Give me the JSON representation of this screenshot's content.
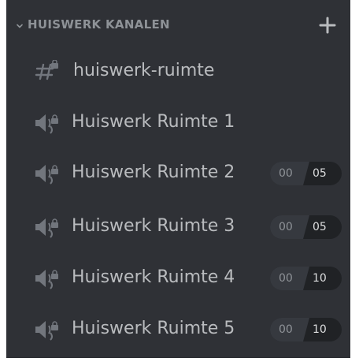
{
  "category": {
    "label": "HUISWERK KANALEN",
    "chevron_icon": "chevron-down-icon",
    "add_icon": "plus-icon"
  },
  "channels": [
    {
      "type": "text",
      "icon": "text-channel-locked-icon",
      "name": "huiswerk-ruimte"
    },
    {
      "type": "voice",
      "icon": "voice-channel-locked-icon",
      "name": "Huiswerk Ruimte 1"
    },
    {
      "type": "voice",
      "icon": "voice-channel-locked-icon",
      "name": "Huiswerk Ruimte 2",
      "users": "00",
      "limit": "05"
    },
    {
      "type": "voice",
      "icon": "voice-channel-locked-icon",
      "name": "Huiswerk Ruimte 3",
      "users": "00",
      "limit": "05"
    },
    {
      "type": "voice",
      "icon": "voice-channel-locked-icon",
      "name": "Huiswerk Ruimte 4",
      "users": "00",
      "limit": "10"
    },
    {
      "type": "voice",
      "icon": "voice-channel-locked-icon",
      "name": "Huiswerk Ruimte 5",
      "users": "00",
      "limit": "10"
    }
  ],
  "colors": {
    "panel_background": "#2f3136",
    "channel_text": "#b9bbbe",
    "category_text": "#8e9297",
    "badge_dark": "#202225",
    "badge_light": "#36393f"
  }
}
